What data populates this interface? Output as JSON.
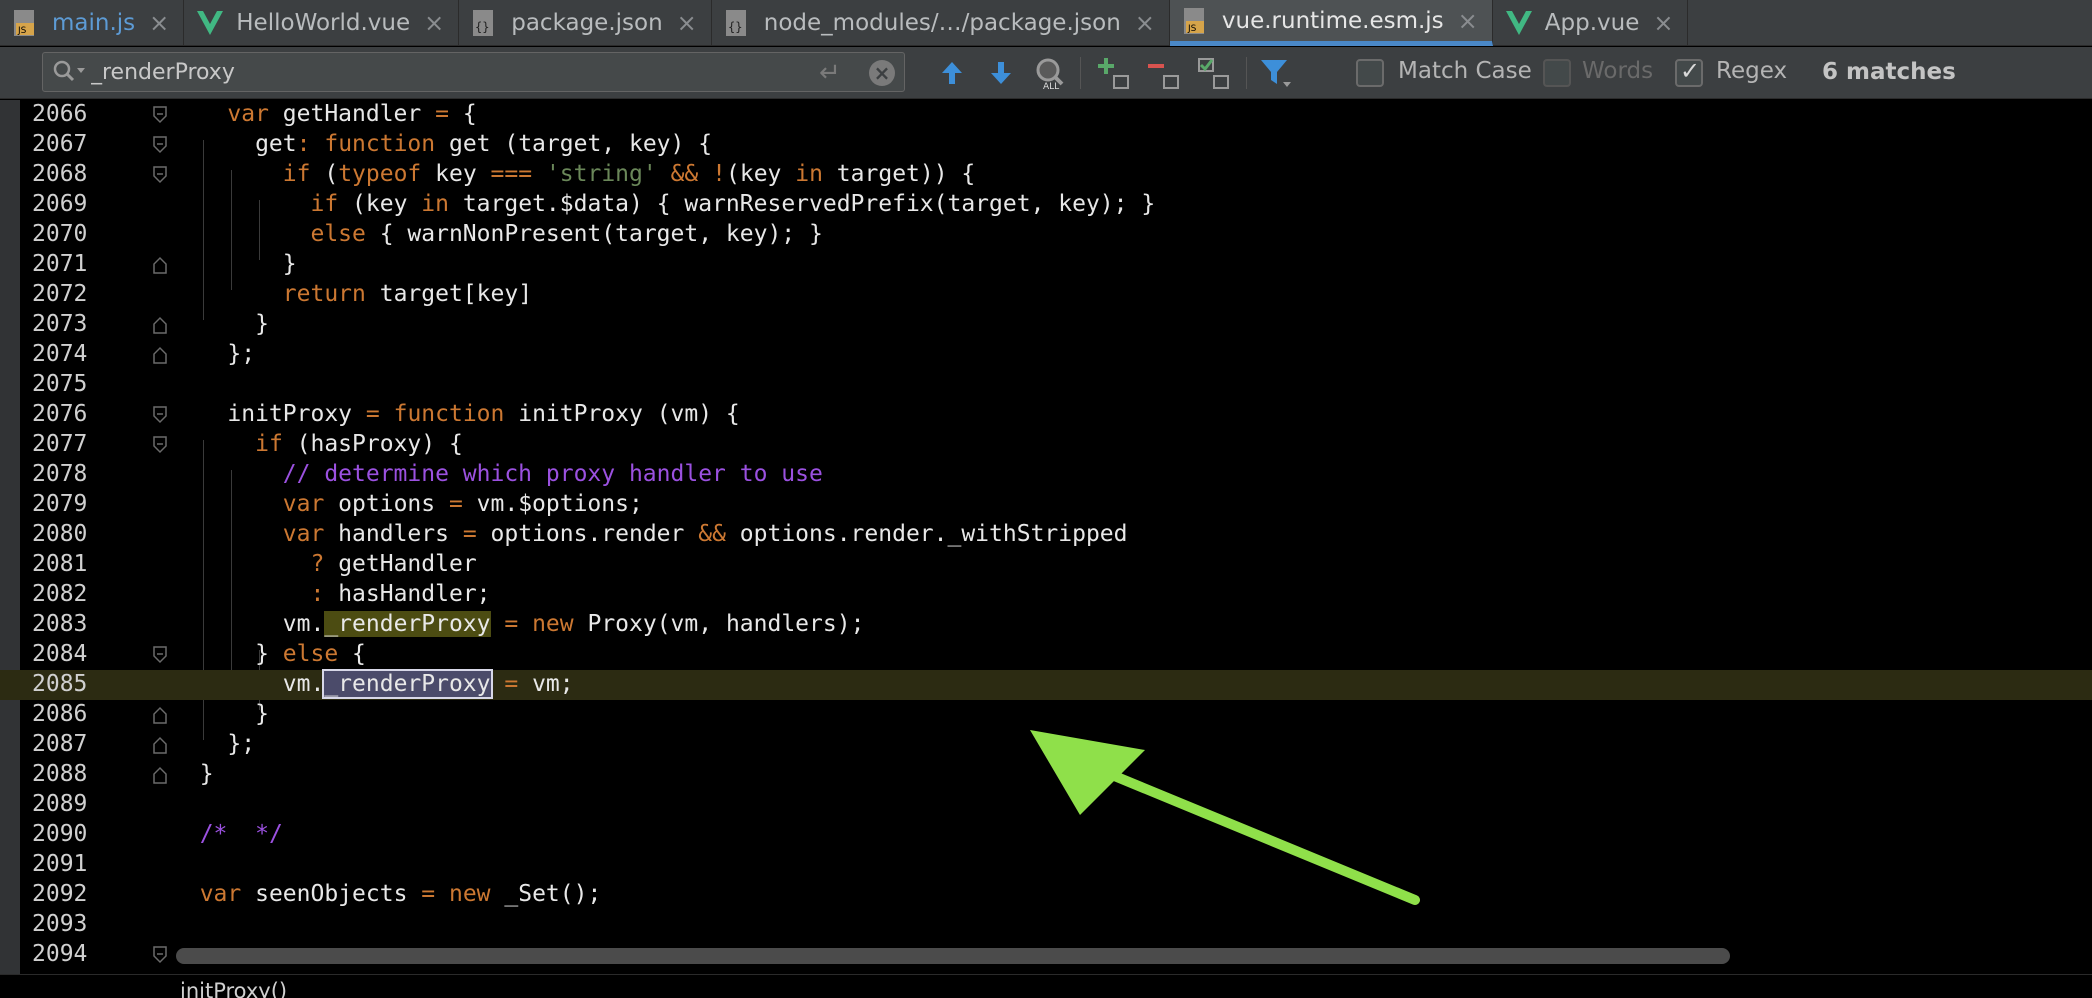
{
  "tabs": [
    {
      "label": "main.js",
      "icon": "js-file-icon",
      "active": false
    },
    {
      "label": "HelloWorld.vue",
      "icon": "vue-file-icon",
      "active": false
    },
    {
      "label": "package.json",
      "icon": "json-file-icon",
      "active": false
    },
    {
      "label": "node_modules/…/package.json",
      "icon": "json-file-icon",
      "active": false
    },
    {
      "label": "vue.runtime.esm.js",
      "icon": "js-file-icon",
      "active": true
    },
    {
      "label": "App.vue",
      "icon": "vue-file-icon",
      "active": false
    }
  ],
  "search": {
    "value": "_renderProxy",
    "options": {
      "match_case": {
        "label": "Match Case",
        "checked": false
      },
      "words": {
        "label": "Words",
        "checked": false
      },
      "regex": {
        "label": "Regex",
        "checked": true
      }
    },
    "matches": "6 matches"
  },
  "editor": {
    "line_numbers": [
      "2066",
      "2067",
      "2068",
      "2069",
      "2070",
      "2071",
      "2072",
      "2073",
      "2074",
      "2075",
      "2076",
      "2077",
      "2078",
      "2079",
      "2080",
      "2081",
      "2082",
      "2083",
      "2084",
      "2085",
      "2086",
      "2087",
      "2088",
      "2089",
      "2090",
      "2091",
      "2092",
      "2093",
      "2094"
    ],
    "current_line": "2085",
    "search_hit_text": "_renderProxy"
  },
  "breadcrumb": "initProxy()",
  "colors": {
    "keyword": "#cc7832",
    "string": "#6a8759",
    "comment": "#9b51e0",
    "annotation_arrow": "#8fe04a"
  }
}
